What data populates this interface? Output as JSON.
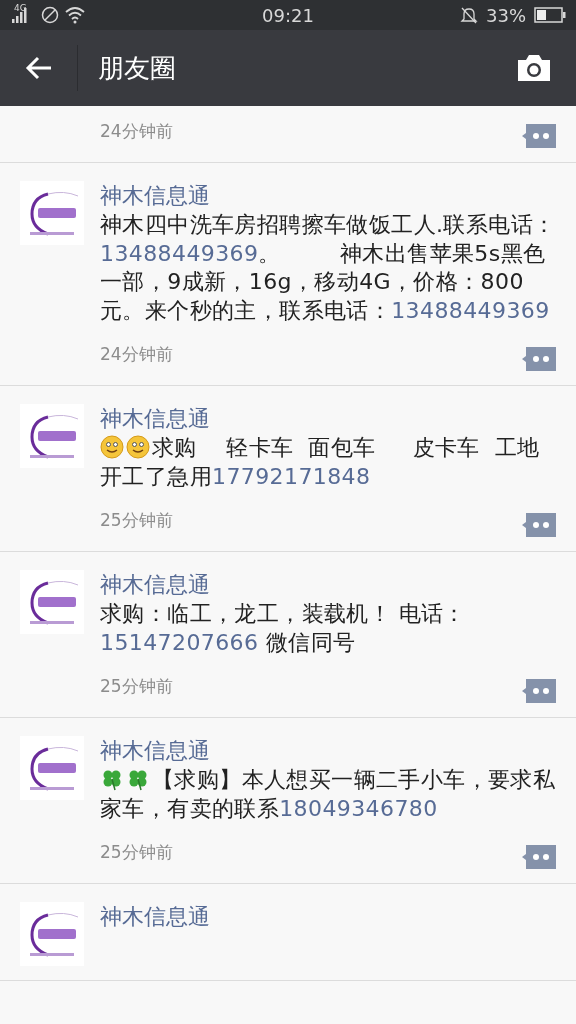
{
  "status_bar": {
    "network": "4G",
    "time": "09:21",
    "battery": "33%"
  },
  "header": {
    "title": "朋友圈"
  },
  "posts": [
    {
      "time": "24分钟前"
    },
    {
      "name": "神木信息通",
      "content": [
        {
          "kind": "text",
          "text": "神木四中洗车房招聘擦车做饭工人.联系电话："
        },
        {
          "kind": "link",
          "text": "13488449369"
        },
        {
          "kind": "text",
          "text": "。        神木出售苹果5s黑色一部，9成新，16g，移动4G，价格：800元。来个秒的主，联系电话："
        },
        {
          "kind": "link",
          "text": "13488449369"
        }
      ],
      "time": "24分钟前"
    },
    {
      "name": "神木信息通",
      "content": [
        {
          "kind": "smiley"
        },
        {
          "kind": "smiley"
        },
        {
          "kind": "text",
          "text": "求购    轻卡车  面包车     皮卡车  工地开工了急用"
        },
        {
          "kind": "link",
          "text": "17792171848"
        }
      ],
      "time": "25分钟前"
    },
    {
      "name": "神木信息通",
      "content": [
        {
          "kind": "text",
          "text": "求购：临工，龙工，装载机！ 电话："
        },
        {
          "kind": "link",
          "text": "15147207666"
        },
        {
          "kind": "text",
          "text": " 微信同号"
        }
      ],
      "time": "25分钟前"
    },
    {
      "name": "神木信息通",
      "content": [
        {
          "kind": "clover"
        },
        {
          "kind": "clover"
        },
        {
          "kind": "text",
          "text": "【求购】本人想买一辆二手小车，要求私家车，有卖的联系"
        },
        {
          "kind": "link",
          "text": "18049346780"
        }
      ],
      "time": "25分钟前"
    },
    {
      "name": "神木信息通"
    }
  ]
}
